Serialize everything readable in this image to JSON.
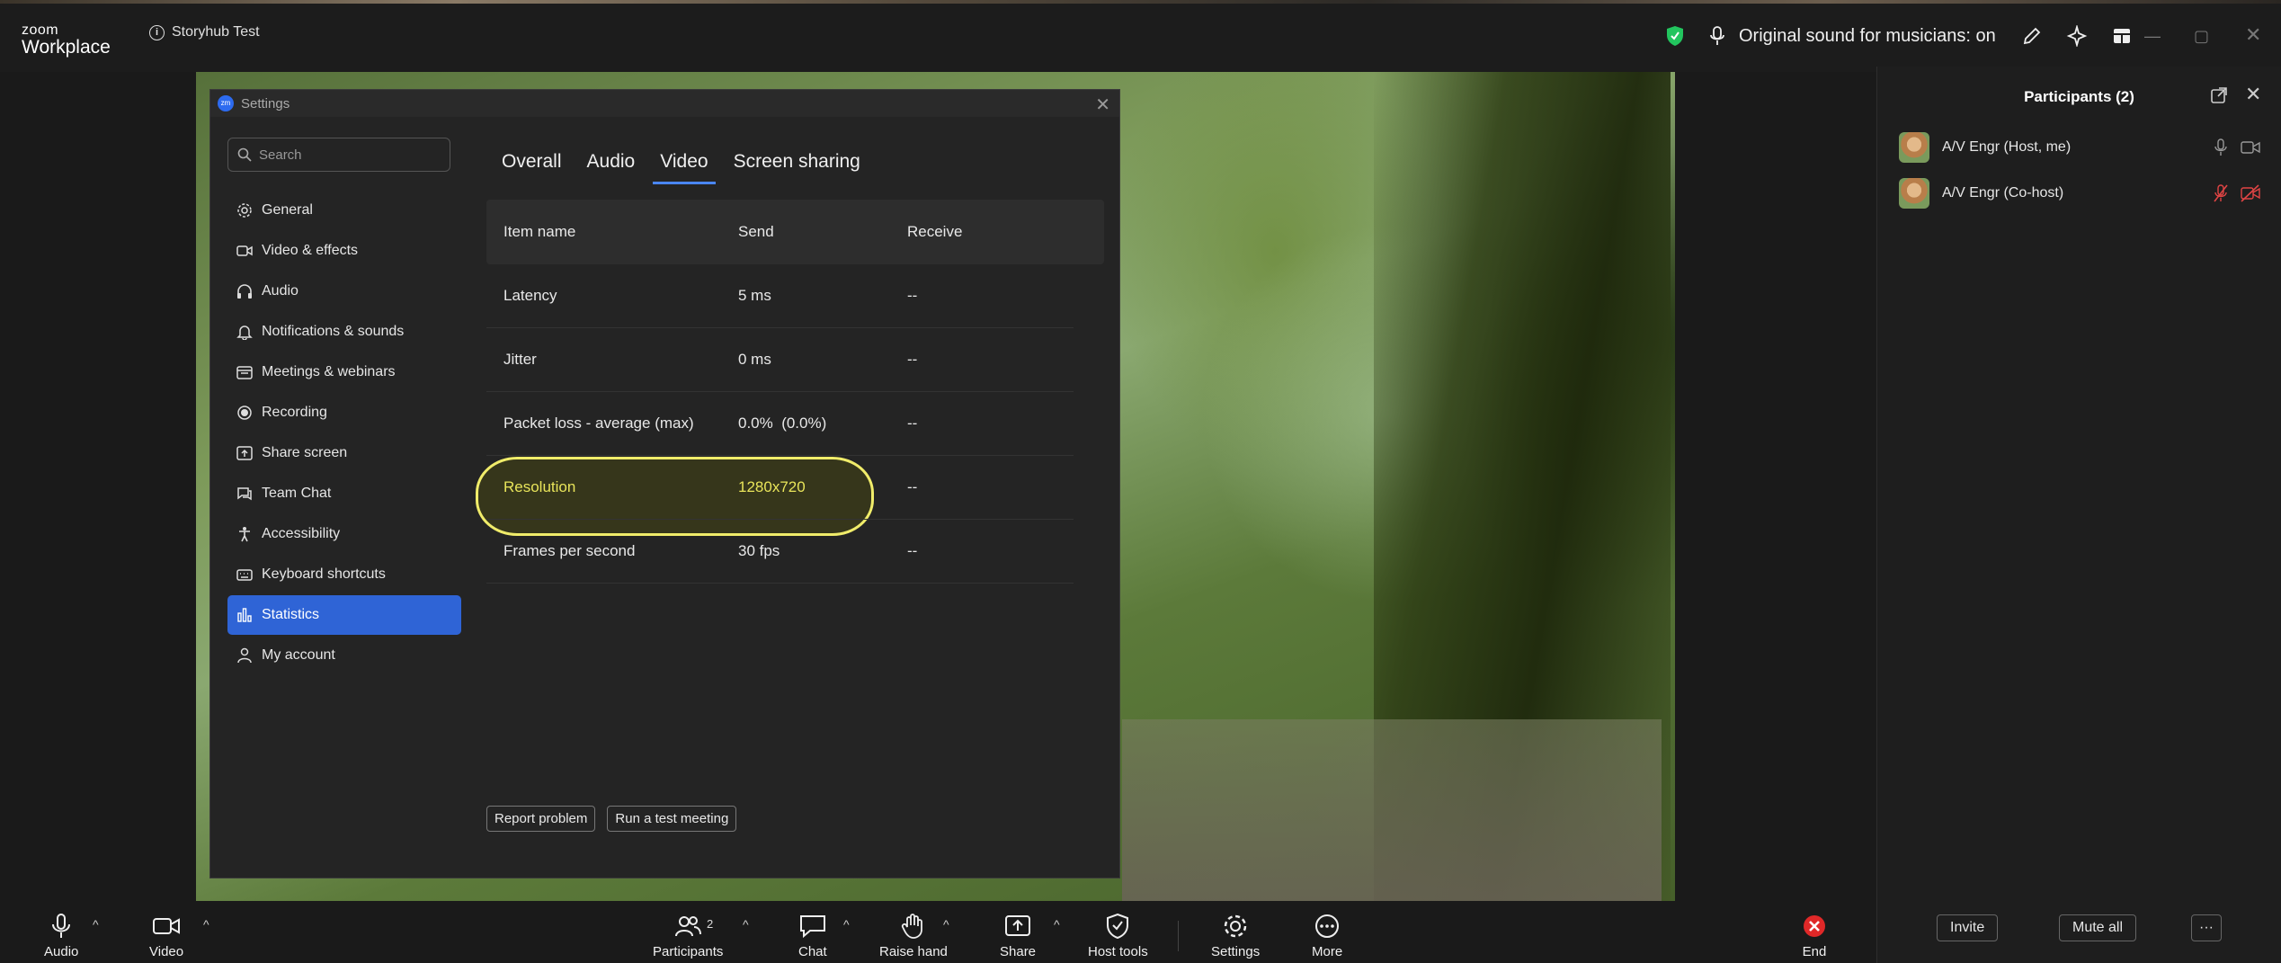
{
  "titlebar": {
    "logo_top": "zoom",
    "logo_bottom": "Workplace",
    "meeting_name": "Storyhub Test",
    "original_sound": "Original sound for musicians: on"
  },
  "settings": {
    "window_title": "Settings",
    "badge": "zm",
    "search_placeholder": "Search",
    "nav": [
      {
        "label": "General",
        "icon": "gear-icon"
      },
      {
        "label": "Video & effects",
        "icon": "video-camera-icon"
      },
      {
        "label": "Audio",
        "icon": "headphones-icon"
      },
      {
        "label": "Notifications & sounds",
        "icon": "bell-icon"
      },
      {
        "label": "Meetings & webinars",
        "icon": "calendar-icon"
      },
      {
        "label": "Recording",
        "icon": "record-icon"
      },
      {
        "label": "Share screen",
        "icon": "share-screen-icon"
      },
      {
        "label": "Team Chat",
        "icon": "chat-icon"
      },
      {
        "label": "Accessibility",
        "icon": "accessibility-icon"
      },
      {
        "label": "Keyboard shortcuts",
        "icon": "keyboard-icon"
      },
      {
        "label": "Statistics",
        "icon": "bar-chart-icon",
        "active": true
      },
      {
        "label": "My account",
        "icon": "user-icon"
      }
    ],
    "tabs": [
      "Overall",
      "Audio",
      "Video",
      "Screen sharing"
    ],
    "active_tab": "Video",
    "table": {
      "headers": [
        "Item name",
        "Send",
        "Receive"
      ],
      "rows": [
        [
          "Latency",
          "5 ms",
          "--"
        ],
        [
          "Jitter",
          "0 ms",
          "--"
        ],
        [
          "Packet loss - average (max)",
          "0.0%  (0.0%)",
          "--"
        ],
        [
          "Resolution",
          "1280x720",
          "--"
        ],
        [
          "Frames per second",
          "30 fps",
          "--"
        ]
      ]
    },
    "report_problem": "Report problem",
    "run_test": "Run a test meeting"
  },
  "participants_panel": {
    "title": "Participants (2)",
    "participants": [
      {
        "name": "A/V Engr (Host, me)",
        "muted": false
      },
      {
        "name": "A/V Engr (Co-host)",
        "muted": true
      }
    ],
    "invite": "Invite",
    "mute_all": "Mute all",
    "more": "···"
  },
  "toolbar": {
    "audio": "Audio",
    "video": "Video",
    "participants": "Participants",
    "participants_count": "2",
    "chat": "Chat",
    "raise_hand": "Raise hand",
    "share": "Share",
    "host_tools": "Host tools",
    "settings": "Settings",
    "more": "More",
    "end": "End"
  },
  "colors": {
    "accent": "#2f64d6",
    "highlight": "#e8e45a",
    "end_red": "#e02828",
    "shield_green": "#22c55e",
    "muted_red": "#e04444"
  }
}
